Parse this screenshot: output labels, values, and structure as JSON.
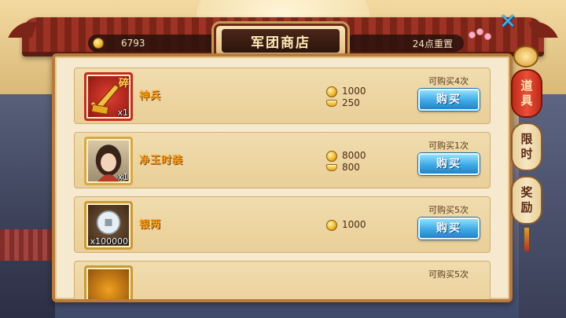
{
  "header": {
    "title": "军团商店",
    "gold_amount": "6793",
    "reset_text": "24点重置"
  },
  "close_label": "✕",
  "items": [
    {
      "name": "神兵",
      "badge": "碎",
      "count": "x1",
      "prices": [
        {
          "currency": "coin",
          "amount": "1000"
        },
        {
          "currency": "ingot",
          "amount": "250"
        }
      ],
      "limit": "可购买4次",
      "buy_label": "购买"
    },
    {
      "name": "净玉时装",
      "badge": "",
      "count": "x1",
      "prices": [
        {
          "currency": "coin",
          "amount": "8000"
        },
        {
          "currency": "ingot",
          "amount": "800"
        }
      ],
      "limit": "可购买1次",
      "buy_label": "购买"
    },
    {
      "name": "银两",
      "badge": "",
      "count": "x100000",
      "prices": [
        {
          "currency": "coin",
          "amount": "1000"
        }
      ],
      "limit": "可购买5次",
      "buy_label": "购买"
    },
    {
      "name": "",
      "badge": "",
      "count": "",
      "prices": [],
      "limit": "可购买5次",
      "buy_label": ""
    }
  ],
  "side_tabs": [
    {
      "label_top": "道",
      "label_bottom": "具",
      "active": true
    },
    {
      "label_top": "限",
      "label_bottom": "时",
      "active": false
    },
    {
      "label_top": "奖",
      "label_bottom": "励",
      "active": false
    }
  ],
  "colors": {
    "accent_red": "#c22a1a",
    "buy_blue": "#3da9e6",
    "item_name_orange": "#f9a21a",
    "panel_bg": "#f5ead0"
  },
  "icons": {
    "currency_coin": "gold-coin-icon",
    "currency_ingot": "gold-ingot-icon",
    "close": "close-x-icon"
  }
}
